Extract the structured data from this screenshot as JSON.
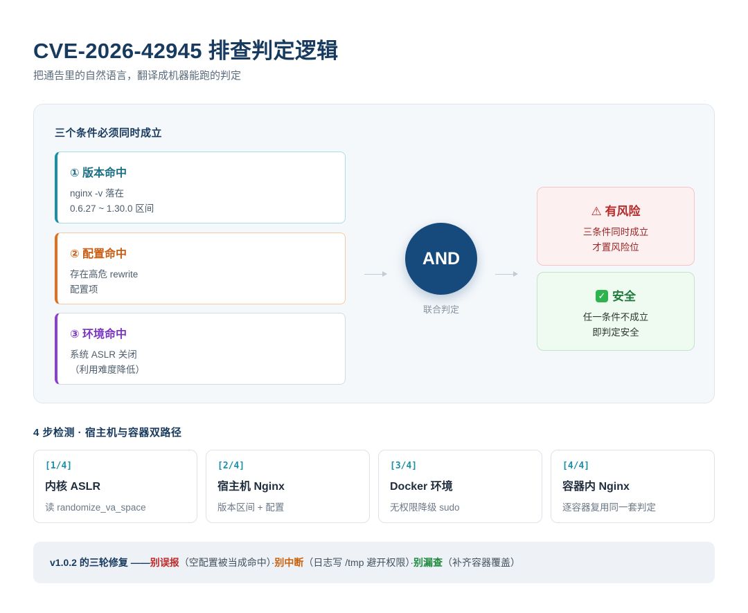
{
  "header": {
    "title": "CVE-2026-42945 排查判定逻辑",
    "subtitle": "把通告里的自然语言，翻译成机器能跑的判定"
  },
  "logic_panel": {
    "title": "三个条件必须同时成立",
    "conditions": [
      {
        "title": "① 版本命中",
        "desc": "nginx -v 落在\n0.6.27 ~ 1.30.0 区间",
        "color": "#1b8fa8"
      },
      {
        "title": "② 配置命中",
        "desc": "存在高危 rewrite\n配置项",
        "color": "#e0701e"
      },
      {
        "title": "③ 环境命中",
        "desc": "系统 ASLR 关闭\n（利用难度降低）",
        "color": "#8a3fd1"
      }
    ],
    "gate": {
      "label": "AND",
      "caption": "联合判定"
    },
    "results": {
      "risk": {
        "icon": "warning-icon",
        "symbol": "⚠",
        "title": "有风险",
        "desc": "三条件同时成立\n才置风险位"
      },
      "safe": {
        "icon": "check-icon",
        "symbol": "✓",
        "title": "安全",
        "desc": "任一条件不成立\n即判定安全"
      }
    }
  },
  "steps": {
    "title": "4 步检测 · 宿主机与容器双路径",
    "items": [
      {
        "num": "[1/4]",
        "title": "内核 ASLR",
        "desc": "读 randomize_va_space"
      },
      {
        "num": "[2/4]",
        "title": "宿主机 Nginx",
        "desc": "版本区间 + 配置"
      },
      {
        "num": "[3/4]",
        "title": "Docker 环境",
        "desc": "无权限降级 sudo"
      },
      {
        "num": "[4/4]",
        "title": "容器内 Nginx",
        "desc": "逐容器复用同一套判定"
      }
    ]
  },
  "footer": {
    "lead": "v1.0.2 的三轮修复 —— ",
    "fix1_label": "别误报",
    "fix1_desc": "（空配置被当成命中）· ",
    "fix2_label": "别中断",
    "fix2_desc": "（日志写 /tmp 避开权限）· ",
    "fix3_label": "别漏查",
    "fix3_desc": "（补齐容器覆盖）"
  },
  "colors": {
    "primary": "#173a5e",
    "gate": "#174a7c",
    "risk": "#b52a2a",
    "safe": "#1d7a3a"
  }
}
